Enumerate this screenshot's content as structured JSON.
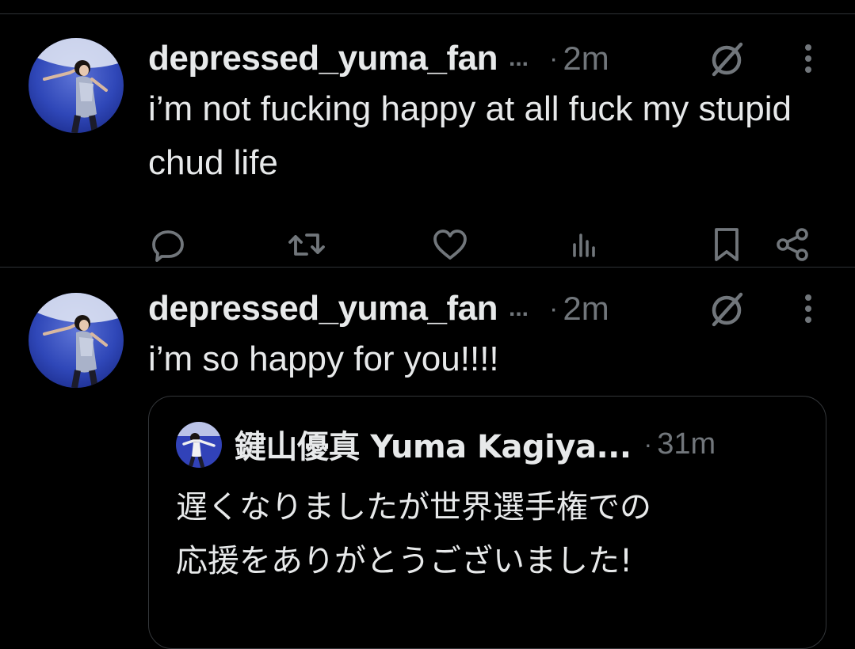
{
  "colors": {
    "background": "#000000",
    "text_primary": "#e7e9ea",
    "text_secondary": "#71767b",
    "divider": "#2f3336"
  },
  "tweets": [
    {
      "username": "depressed_yuma_fan",
      "ellipsis": "...",
      "separator": "·",
      "time": "2m",
      "text": "i’m not fucking happy at all fuck my stupid chud life",
      "avatar_icon": "figure-skater-avatar",
      "meta_icon": "grok-icon",
      "more_icon": "more-vertical-icon",
      "actions": [
        {
          "name": "reply-icon"
        },
        {
          "name": "retweet-icon"
        },
        {
          "name": "like-icon"
        },
        {
          "name": "views-icon"
        },
        {
          "name": "bookmark-icon"
        },
        {
          "name": "share-icon"
        }
      ]
    },
    {
      "username": "depressed_yuma_fan",
      "ellipsis": "...",
      "separator": "·",
      "time": "2m",
      "text": "i’m so happy for you!!!!",
      "avatar_icon": "figure-skater-avatar",
      "meta_icon": "grok-icon",
      "more_icon": "more-vertical-icon",
      "quote": {
        "name": "鍵山優真 Yuma Kagiya...",
        "separator": "·",
        "time": "31m",
        "line1": "遅くなりましたが世界選手権での",
        "line2": "応援をありがとうございました!"
      }
    }
  ]
}
